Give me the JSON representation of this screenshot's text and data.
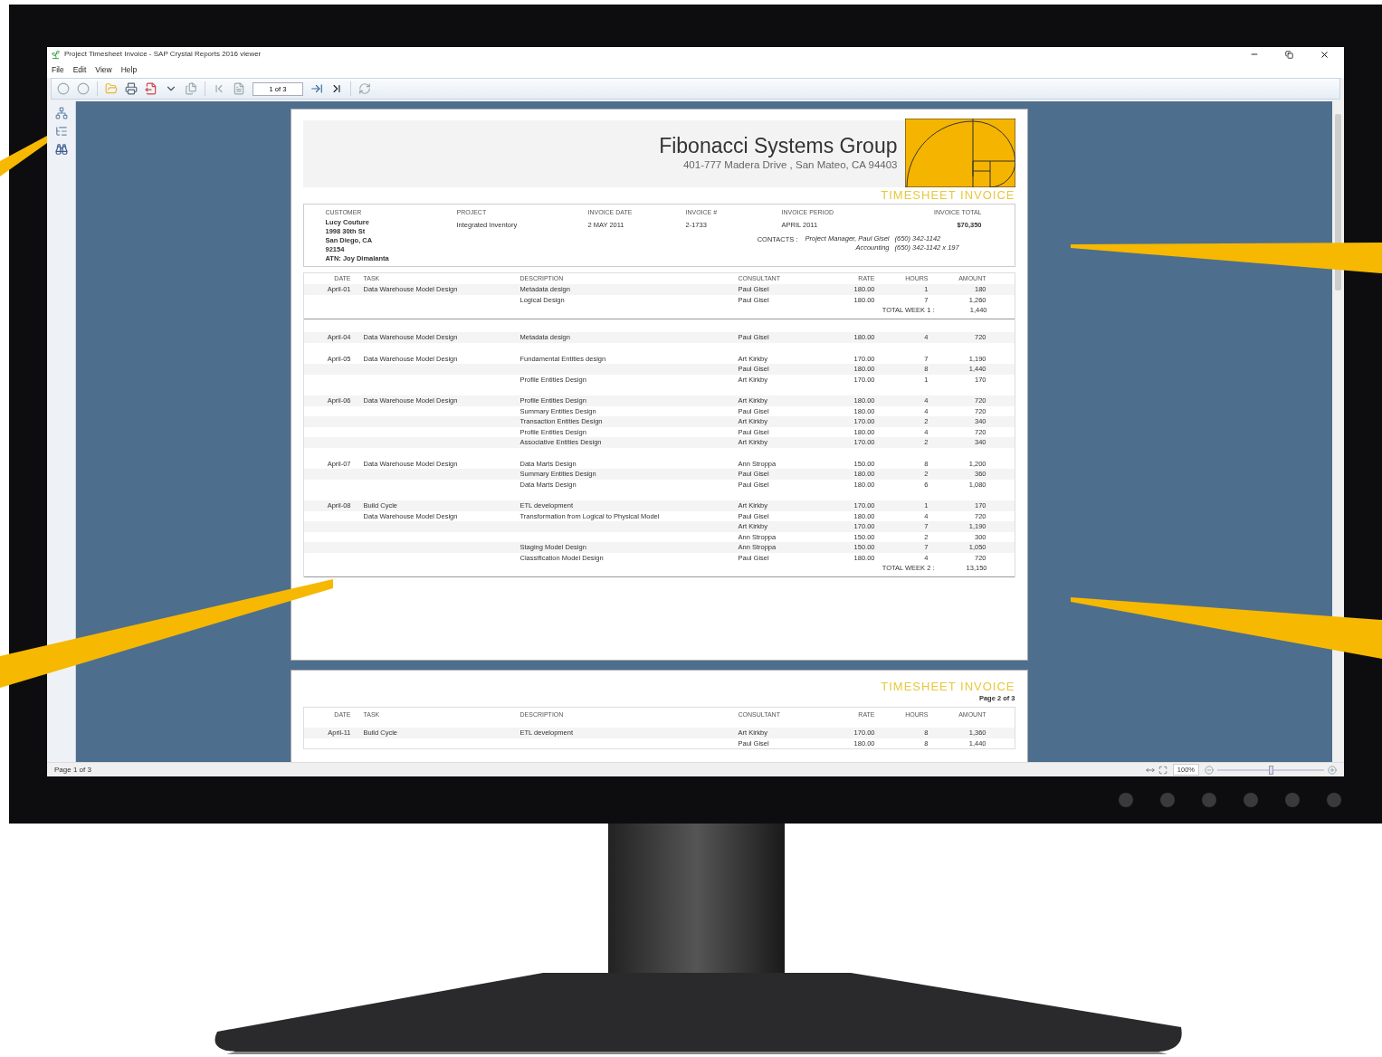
{
  "window": {
    "title": "Project Timesheet Invoice - SAP Crystal Reports 2016 viewer"
  },
  "menu": [
    "File",
    "Edit",
    "View",
    "Help"
  ],
  "toolbar": {
    "page_field": "1 of 3"
  },
  "page1": {
    "company": "Fibonacci Systems Group",
    "address": "401-777 Madera Drive , San Mateo, CA  94403",
    "report_title": "TIMESHEET INVOICE",
    "info": {
      "customer_label": "CUSTOMER",
      "customer_lines": [
        "Lucy Couture",
        "1998 30th St",
        "San Diego, CA",
        "92154",
        "ATN: Joy Dimalanta"
      ],
      "fields": [
        {
          "label": "PROJECT",
          "value": "Integrated Inventory"
        },
        {
          "label": "INVOICE DATE",
          "value": "2 MAY 2011"
        },
        {
          "label": "INVOICE #",
          "value": "2-1733"
        },
        {
          "label": "INVOICE PERIOD",
          "value": "APRIL 2011"
        },
        {
          "label": "INVOICE TOTAL",
          "value": "$70,350"
        }
      ],
      "contacts_label": "CONTACTS :",
      "contacts": [
        {
          "role": "Project Manager, Paul Gisel",
          "phone": "(650) 342-1142"
        },
        {
          "role": "Accounting",
          "phone": "(650) 342-1142 x 197"
        }
      ]
    },
    "columns": [
      "DATE",
      "TASK",
      "DESCRIPTION",
      "CONSULTANT",
      "RATE",
      "HOURS",
      "AMOUNT"
    ],
    "weeks": [
      {
        "days": [
          {
            "rows": [
              {
                "date": "April-01",
                "task": "Data Warehouse Model Design",
                "description": "Metadata design",
                "consultant": "Paul Gisel",
                "rate": "180.00",
                "hours": "1",
                "amount": "180"
              },
              {
                "description": "Logical Design",
                "consultant": "Paul Gisel",
                "rate": "180.00",
                "hours": "7",
                "amount": "1,260"
              }
            ]
          }
        ],
        "total_label": "TOTAL WEEK 1 :",
        "total": "1,440"
      },
      {
        "days": [
          {
            "rows": [
              {
                "date": "April-04",
                "task": "Data Warehouse Model Design",
                "description": "Metadata design",
                "consultant": "Paul Gisel",
                "rate": "180.00",
                "hours": "4",
                "amount": "720"
              }
            ]
          },
          {
            "rows": [
              {
                "date": "April-05",
                "task": "Data Warehouse Model Design",
                "description": "Fundamental Entities design",
                "consultant": "Art Kirkby",
                "rate": "170.00",
                "hours": "7",
                "amount": "1,190"
              },
              {
                "consultant": "Paul Gisel",
                "rate": "180.00",
                "hours": "8",
                "amount": "1,440"
              },
              {
                "description": "Profile Entities Design",
                "consultant": "Art Kirkby",
                "rate": "170.00",
                "hours": "1",
                "amount": "170"
              }
            ]
          },
          {
            "rows": [
              {
                "date": "April-06",
                "task": "Data Warehouse Model Design",
                "description": "Profile Entities Design",
                "consultant": "Art Kirkby",
                "rate": "180.00",
                "hours": "4",
                "amount": "720"
              },
              {
                "description": "Summary Entities Design",
                "consultant": "Paul Gisel",
                "rate": "180.00",
                "hours": "4",
                "amount": "720"
              },
              {
                "description": "Transaction Entities Design",
                "consultant": "Art Kirkby",
                "rate": "170.00",
                "hours": "2",
                "amount": "340"
              },
              {
                "description": "Profile Entities Design",
                "consultant": "Paul Gisel",
                "rate": "180.00",
                "hours": "4",
                "amount": "720"
              },
              {
                "description": "Associative Entities Design",
                "consultant": "Art Kirkby",
                "rate": "170.00",
                "hours": "2",
                "amount": "340"
              }
            ]
          },
          {
            "rows": [
              {
                "date": "April-07",
                "task": "Data Warehouse Model Design",
                "description": "Data Marts Design",
                "consultant": "Ann Stroppa",
                "rate": "150.00",
                "hours": "8",
                "amount": "1,200"
              },
              {
                "description": "Summary Entities Design",
                "consultant": "Paul Gisel",
                "rate": "180.00",
                "hours": "2",
                "amount": "360"
              },
              {
                "description": "Data Marts Design",
                "consultant": "Paul Gisel",
                "rate": "180.00",
                "hours": "6",
                "amount": "1,080"
              }
            ]
          },
          {
            "rows": [
              {
                "date": "April-08",
                "task": "Build Cycle",
                "description": "ETL development",
                "consultant": "Art Kirkby",
                "rate": "170.00",
                "hours": "1",
                "amount": "170"
              },
              {
                "task": "Data Warehouse Model Design",
                "description": "Transformation from Logical to Physical Model",
                "consultant": "Paul Gisel",
                "rate": "180.00",
                "hours": "4",
                "amount": "720"
              },
              {
                "consultant": "Art Kirkby",
                "rate": "170.00",
                "hours": "7",
                "amount": "1,190"
              },
              {
                "consultant": "Ann Stroppa",
                "rate": "150.00",
                "hours": "2",
                "amount": "300"
              },
              {
                "description": "Staging Model Design",
                "consultant": "Ann Stroppa",
                "rate": "150.00",
                "hours": "7",
                "amount": "1,050"
              },
              {
                "description": "Classification Model Design",
                "consultant": "Paul Gisel",
                "rate": "180.00",
                "hours": "4",
                "amount": "720"
              }
            ]
          }
        ],
        "total_label": "TOTAL WEEK 2 :",
        "total": "13,150"
      }
    ]
  },
  "page2": {
    "report_title": "TIMESHEET INVOICE",
    "page_label": "Page 2 of 3",
    "columns": [
      "DATE",
      "TASK",
      "DESCRIPTION",
      "CONSULTANT",
      "RATE",
      "HOURS",
      "AMOUNT"
    ],
    "rows": [
      {
        "date": "April-11",
        "task": "Build Cycle",
        "description": "ETL development",
        "consultant": "Art Kirkby",
        "rate": "170.00",
        "hours": "8",
        "amount": "1,360"
      },
      {
        "consultant": "Paul Gisel",
        "rate": "180.00",
        "hours": "8",
        "amount": "1,440"
      }
    ]
  },
  "status_bar": {
    "page": "Page 1 of 3",
    "zoom": "100%",
    "zoom_slider": {
      "level": 0.5
    }
  }
}
